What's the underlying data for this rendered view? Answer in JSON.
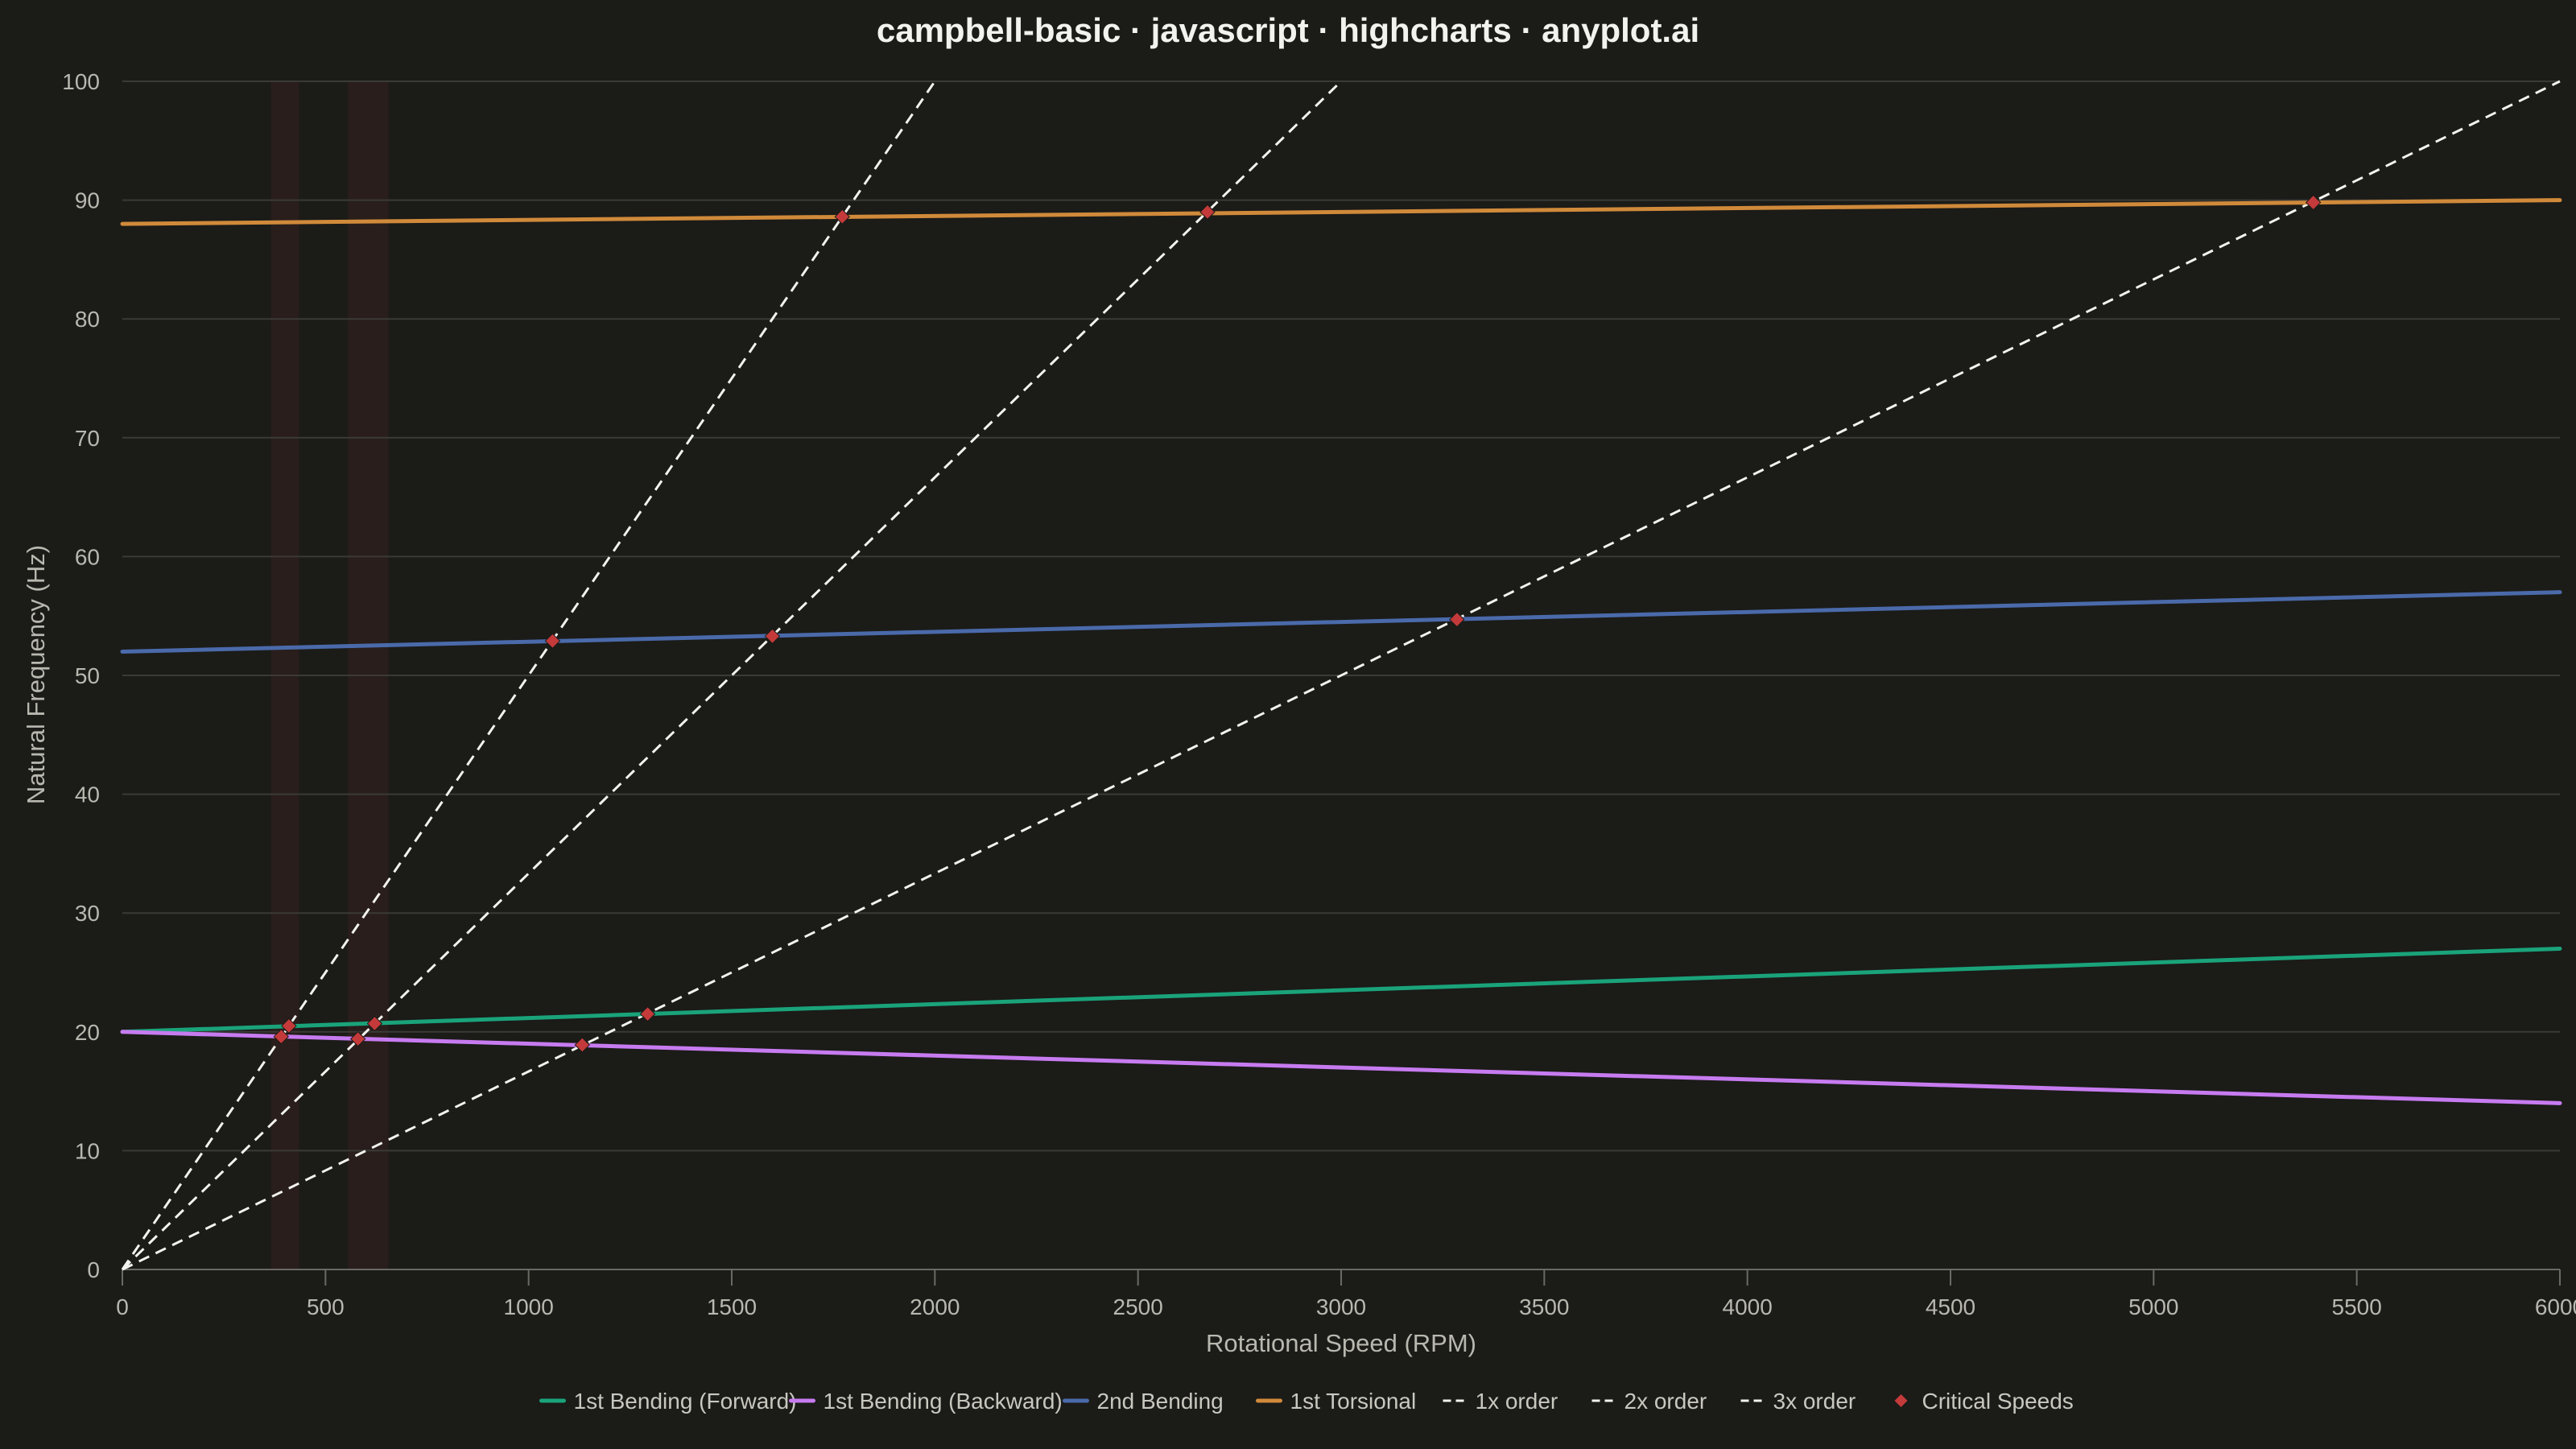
{
  "chart_data": {
    "type": "line",
    "title": "campbell-basic · javascript · highcharts · anyplot.ai",
    "xlabel": "Rotational Speed (RPM)",
    "ylabel": "Natural Frequency (Hz)",
    "xlim": [
      0,
      6000
    ],
    "ylim": [
      0,
      100
    ],
    "x_ticks": [
      0,
      500,
      1000,
      1500,
      2000,
      2500,
      3000,
      3500,
      4000,
      4500,
      5000,
      5500,
      6000
    ],
    "y_ticks": [
      0,
      10,
      20,
      30,
      40,
      50,
      60,
      70,
      80,
      90,
      100
    ],
    "grid": true,
    "legend_position": "bottom-center",
    "modes": [
      {
        "name": "1st Bending (Forward)",
        "color": "#1aa37a",
        "x": [
          0,
          6000
        ],
        "y": [
          20,
          27
        ]
      },
      {
        "name": "1st Bending (Backward)",
        "color": "#c77bf0",
        "x": [
          0,
          6000
        ],
        "y": [
          20,
          14
        ]
      },
      {
        "name": "2nd Bending",
        "color": "#4a6aaa",
        "x": [
          0,
          6000
        ],
        "y": [
          52,
          57
        ]
      },
      {
        "name": "1st Torsional",
        "color": "#d08a3a",
        "x": [
          0,
          6000
        ],
        "y": [
          88,
          90
        ]
      }
    ],
    "orders": [
      {
        "name": "1x order",
        "order": 1,
        "color": "#f2f2ee"
      },
      {
        "name": "2x order",
        "order": 2,
        "color": "#f2f2ee"
      },
      {
        "name": "3x order",
        "order": 3,
        "color": "#f2f2ee"
      }
    ],
    "critical_speeds": {
      "name": "Critical Speeds",
      "color": "#c43a3a",
      "points": [
        {
          "x": 391,
          "y": 19.6
        },
        {
          "x": 410,
          "y": 20.5
        },
        {
          "x": 580,
          "y": 19.4
        },
        {
          "x": 621,
          "y": 20.7
        },
        {
          "x": 1059,
          "y": 52.9
        },
        {
          "x": 1132,
          "y": 18.9
        },
        {
          "x": 1293,
          "y": 21.5
        },
        {
          "x": 1600,
          "y": 53.3
        },
        {
          "x": 1772,
          "y": 88.6
        },
        {
          "x": 2671,
          "y": 89.0
        },
        {
          "x": 3285,
          "y": 54.7
        },
        {
          "x": 5393,
          "y": 89.8
        }
      ]
    },
    "shaded_bands": [
      {
        "from": 366,
        "to": 435
      },
      {
        "from": 555,
        "to": 655
      }
    ]
  }
}
